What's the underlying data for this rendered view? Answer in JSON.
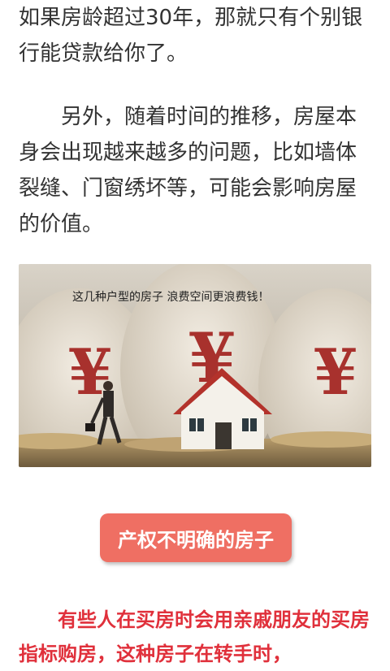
{
  "article": {
    "paragraph1": "如果房龄超过30年，那就只有个别银行能贷款给你了。",
    "paragraph2": "　　另外，随着时间的推移，房屋本身会出现越来越多的问题，比如墙体裂缝、门窗绣坏等，可能会影响房屋的价值。",
    "image_caption": "这几种户型的房子 浪费空间更浪费钱！",
    "yuan_symbol": "¥",
    "section_title": "产权不明确的房子",
    "paragraph3": "　　有些人在买房时会用亲戚朋友的买房指标购房，这种房子在转手时，"
  },
  "colors": {
    "body_text": "#333333",
    "accent_red": "#e0303b",
    "badge_bg": "#ef6f63"
  }
}
